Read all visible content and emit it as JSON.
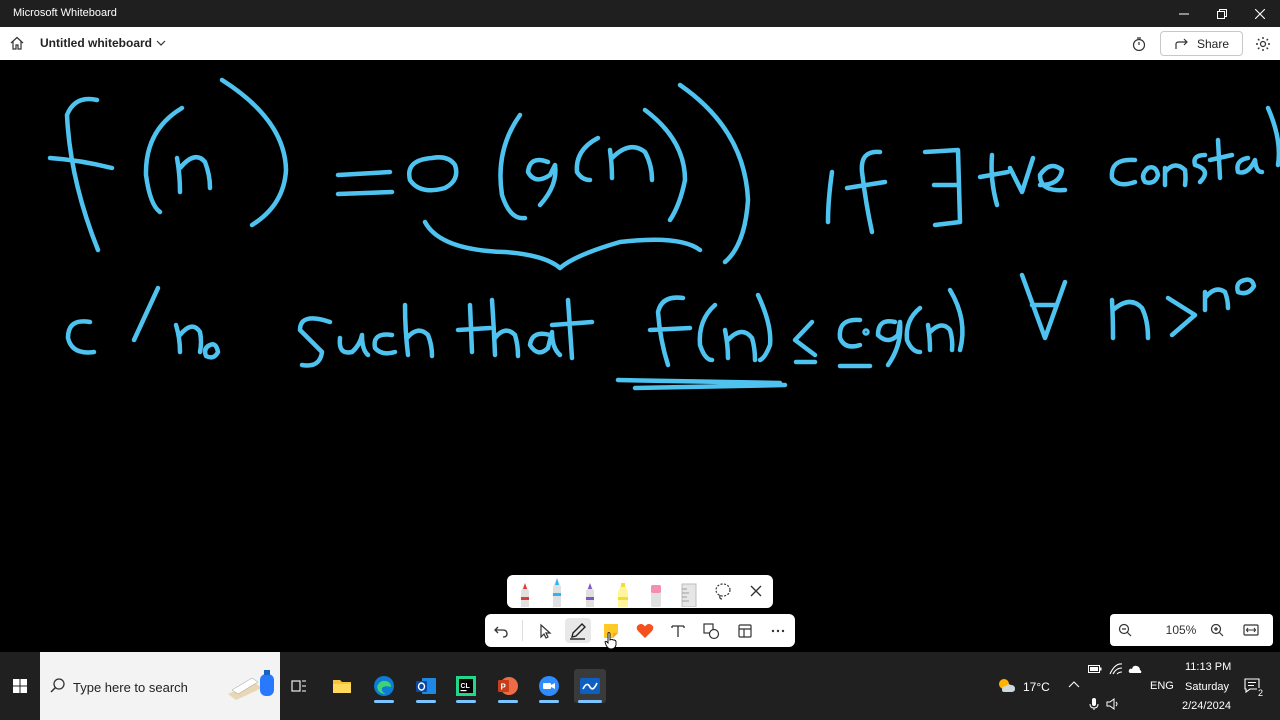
{
  "window": {
    "title": "Microsoft Whiteboard"
  },
  "header": {
    "board_name": "Untitled whiteboard",
    "share_label": "Share"
  },
  "canvas": {
    "ink_color": "#4ec3f0"
  },
  "pen_tray": {
    "pens": [
      {
        "name": "red-pen",
        "color": "#e53935"
      },
      {
        "name": "blue-pen",
        "color": "#29b6f6",
        "selected": true
      },
      {
        "name": "purple-pen",
        "color": "#7e57c2"
      },
      {
        "name": "yellow-highlighter",
        "color": "#fdd835"
      },
      {
        "name": "eraser",
        "color": "#f48fb1"
      },
      {
        "name": "ruler",
        "color": "#bdbdbd"
      }
    ]
  },
  "toolbar": {
    "tools": [
      "undo-icon",
      "select-icon",
      "pen-icon",
      "sticky-note-icon",
      "reaction-icon",
      "text-icon",
      "shapes-icon",
      "templates-icon",
      "more-icon"
    ],
    "active_tool": "pen-icon"
  },
  "zoom": {
    "level": "105%"
  },
  "taskbar": {
    "search_placeholder": "Type here to search",
    "weather_temp": "17°C",
    "language": "ENG",
    "time": "11:13 PM",
    "day": "Saturday",
    "date": "2/24/2024",
    "notification_count": "2",
    "apps": [
      "file-explorer-icon",
      "edge-icon",
      "outlook-icon",
      "clion-icon",
      "powerpoint-icon",
      "zoom-icon",
      "whiteboard-icon"
    ]
  }
}
